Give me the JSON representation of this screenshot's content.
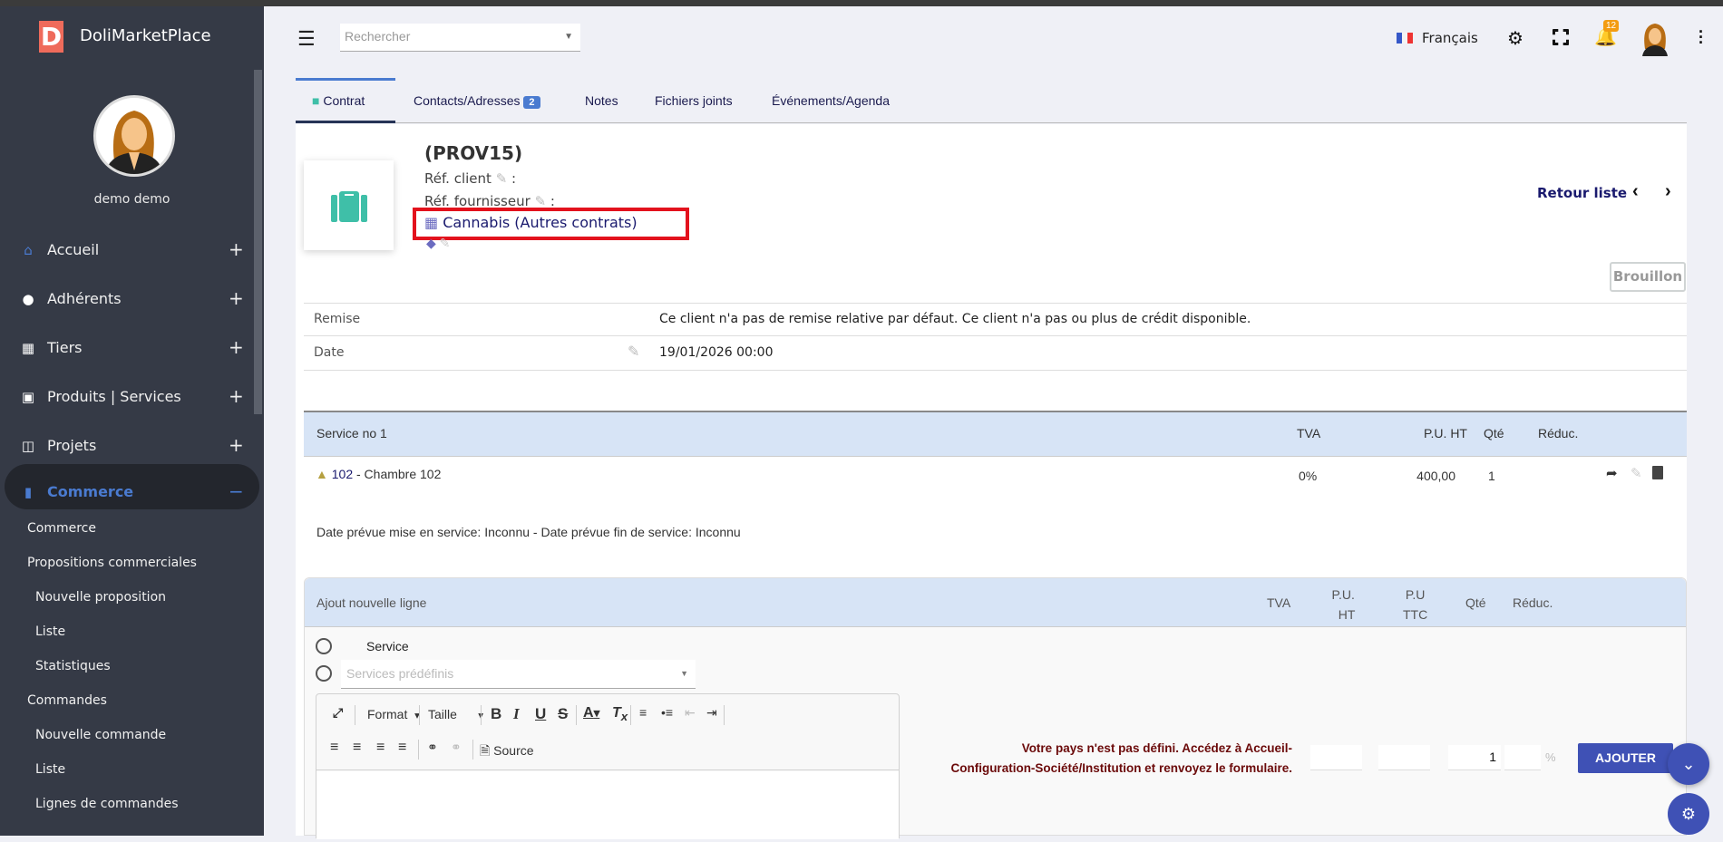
{
  "app": {
    "name": "DoliMarketPlace",
    "logo_letter": "D",
    "user": "demo demo"
  },
  "sidebar": {
    "menu": [
      {
        "label": "Accueil",
        "icon": "home-icon"
      },
      {
        "label": "Adhérents",
        "icon": "user-icon"
      },
      {
        "label": "Tiers",
        "icon": "building-icon"
      },
      {
        "label": "Produits | Services",
        "icon": "cube-icon"
      },
      {
        "label": "Projets",
        "icon": "sitemap-icon"
      },
      {
        "label": "Commerce",
        "icon": "briefcase-icon",
        "expanded": true
      }
    ],
    "submenu": [
      {
        "label": "Commerce",
        "level": 1
      },
      {
        "label": "Propositions commerciales",
        "level": 1
      },
      {
        "label": "Nouvelle proposition",
        "level": 2
      },
      {
        "label": "Liste",
        "level": 2
      },
      {
        "label": "Statistiques",
        "level": 2
      },
      {
        "label": "Commandes",
        "level": 1
      },
      {
        "label": "Nouvelle commande",
        "level": 2
      },
      {
        "label": "Liste",
        "level": 2
      },
      {
        "label": "Lignes de commandes",
        "level": 2
      }
    ]
  },
  "header": {
    "search_placeholder": "Rechercher",
    "language": "Français",
    "notifications": "12"
  },
  "tabs": [
    {
      "label": "Contrat"
    },
    {
      "label": "Contacts/Adresses",
      "badge": "2"
    },
    {
      "label": "Notes"
    },
    {
      "label": "Fichiers joints"
    },
    {
      "label": "Événements/Agenda"
    }
  ],
  "contract": {
    "ref": "(PROV15)",
    "ref_client": "Réf. client",
    "ref_supplier": "Réf. fournisseur",
    "colon": ":",
    "thirdparty": "Cannabis (Autres contrats)",
    "back": "Retour liste",
    "status": "Brouillon"
  },
  "fields": [
    {
      "label": "Remise",
      "value": "Ce client n'a pas de remise relative par défaut. Ce client n'a pas ou plus de crédit disponible."
    },
    {
      "label": "Date",
      "value": "19/01/2026 00:00"
    }
  ],
  "services": {
    "header": {
      "title": "Service no 1",
      "tva": "TVA",
      "pu_ht": "P.U. HT",
      "qty": "Qté",
      "reduc": "Réduc."
    },
    "line": {
      "code": "102",
      "label": " - Chambre 102",
      "tva": "0%",
      "pu_ht": "400,00",
      "qty": "1"
    },
    "dates": "Date prévue mise en service: Inconnu  -  Date prévue fin de service: Inconnu"
  },
  "add_line": {
    "title": "Ajout nouvelle ligne",
    "tva": "TVA",
    "pu_ht_1": "P.U.",
    "pu_ht_2": "HT",
    "pu_ttc_1": "P.U",
    "pu_ttc_2": "TTC",
    "qty": "Qté",
    "reduc": "Réduc.",
    "radio_service": "Service",
    "predef_placeholder": "Services prédéfinis",
    "editor": {
      "format": "Format",
      "size": "Taille",
      "source": "Source"
    },
    "warning_1": "Votre pays n'est pas défini. Accédez à Accueil-",
    "warning_2": "Configuration-Société/Institution et renvoyez le formulaire.",
    "qty_value": "1",
    "percent": "%",
    "add_button": "AJOUTER"
  }
}
